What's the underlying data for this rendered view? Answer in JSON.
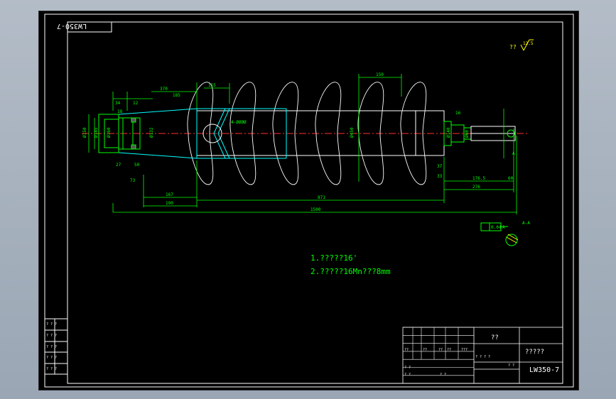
{
  "drawing": {
    "stamp_code": "LW350-7",
    "roughness_prefix": "??",
    "roughness_value": "12.5",
    "notes": [
      "1.?????16'",
      "2.?????16Mn???8mm"
    ],
    "dims": {
      "d34": "34",
      "d12": "12",
      "d370": "370",
      "d185": "185",
      "d155": "155",
      "d150": "150",
      "d4holes": "4-ØØØØ",
      "d167": "167",
      "d190": "190",
      "d871": "871",
      "d1500": "1500",
      "d1765": "176.5",
      "d276": "276",
      "d60": "60",
      "d37": "37",
      "d33": "33",
      "d50": "50",
      "d73": "73",
      "d27": "27",
      "d18a": "18",
      "d16": "16",
      "dia_pitch": "Ø450",
      "dia_left1": "Ø150",
      "dia_left2": "Ø145",
      "dia_left3": "Ø160",
      "dia_left4": "Ø132",
      "dia_right1": "Ø140",
      "dia_right2": "Ø60",
      "section_label": "A-A",
      "mark_a": "A"
    },
    "tolerance_frame": {
      "c1": "0.04",
      "c2": "A"
    },
    "title_block": {
      "name": "??",
      "material": "?????",
      "drawing_no": "LW350-7",
      "row_labels": [
        "??",
        "??",
        "??",
        "??",
        "???"
      ],
      "sheet_labels": [
        "? ?",
        "? ?"
      ],
      "scale_labels": [
        "? ? ? ?",
        "? ?",
        "? ?"
      ]
    },
    "side_table": [
      "? ? ?",
      "? ? ?",
      "? ? ?",
      "? ? ?",
      "? ? ?"
    ]
  }
}
